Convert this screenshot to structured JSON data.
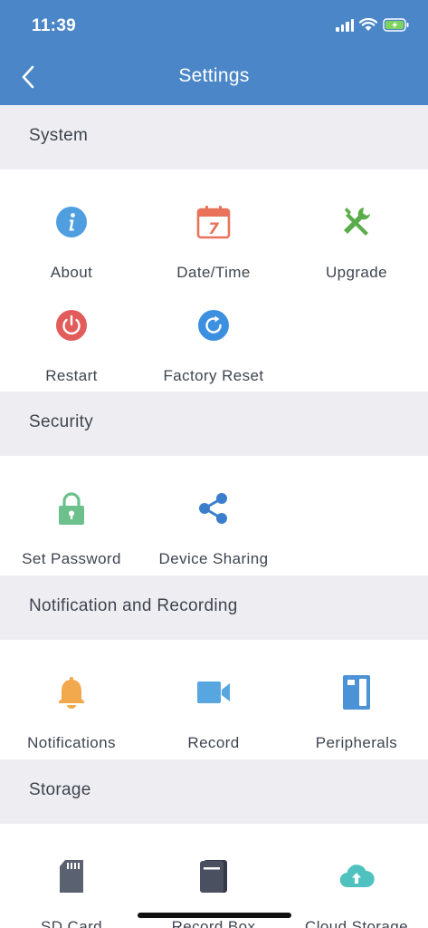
{
  "status_bar": {
    "time": "11:39"
  },
  "header": {
    "title": "Settings"
  },
  "sections": [
    {
      "title": "System",
      "items": [
        {
          "label": "About",
          "icon": "info-icon"
        },
        {
          "label": "Date/Time",
          "icon": "calendar-icon",
          "calendar_day": "7"
        },
        {
          "label": "Upgrade",
          "icon": "tools-icon"
        },
        {
          "label": "Restart",
          "icon": "power-icon"
        },
        {
          "label": "Factory Reset",
          "icon": "reset-icon"
        }
      ]
    },
    {
      "title": "Security",
      "items": [
        {
          "label": "Set Password",
          "icon": "lock-icon"
        },
        {
          "label": "Device Sharing",
          "icon": "share-icon"
        }
      ]
    },
    {
      "title": "Notification and Recording",
      "items": [
        {
          "label": "Notifications",
          "icon": "bell-icon"
        },
        {
          "label": "Record",
          "icon": "video-camera-icon"
        },
        {
          "label": "Peripherals",
          "icon": "peripherals-icon"
        }
      ]
    },
    {
      "title": "Storage",
      "items": [
        {
          "label": "SD Card",
          "icon": "sd-card-icon"
        },
        {
          "label": "Record Box",
          "icon": "record-box-icon"
        },
        {
          "label": "Cloud Storage",
          "icon": "cloud-upload-icon"
        }
      ]
    }
  ],
  "colors": {
    "header": "#4a86c8",
    "section_bg": "#eeeef2",
    "info": "#4f9ee0",
    "calendar": "#e8735a",
    "tools": "#5aad4a",
    "power": "#e25c5c",
    "reset": "#3d8fe0",
    "lock": "#6cc08b",
    "share": "#3b7fcc",
    "bell": "#f2a94e",
    "camera": "#58a6e0",
    "peripherals": "#4b92d6",
    "sd_card": "#5a6171",
    "record_box": "#4a5060",
    "cloud": "#4fc2bf"
  }
}
